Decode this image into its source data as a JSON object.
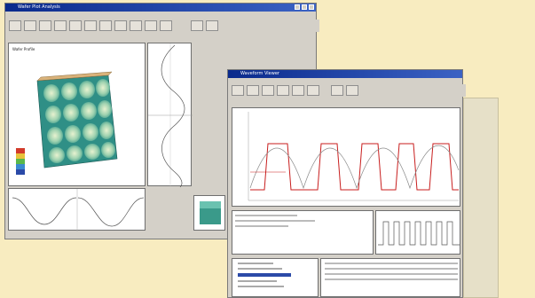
{
  "windows": {
    "left": {
      "title": "Wafer Plot Analysis",
      "panel_label": "Wafer Profile"
    },
    "right": {
      "title": "Waveform Viewer"
    }
  },
  "colors": {
    "background": "#f8ecc0",
    "titlebar": "#0a2a8c",
    "trace_red": "#c81e1e",
    "trace_gray": "#8a8a8a"
  }
}
